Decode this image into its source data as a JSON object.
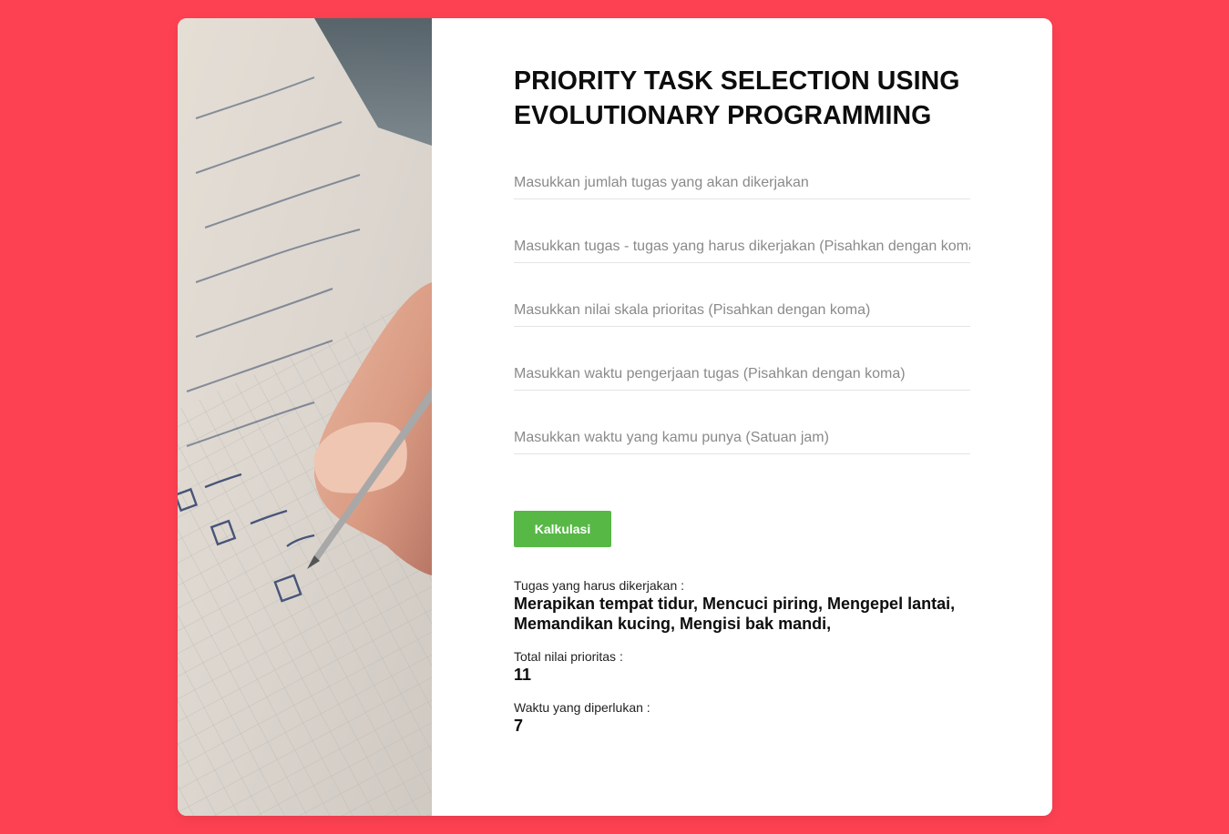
{
  "header": {
    "title_line1": "PRIORITY TASK SELECTION USING",
    "title_line2": "EVOLUTIONARY PROGRAMMING"
  },
  "form": {
    "fields": [
      {
        "placeholder": "Masukkan jumlah tugas yang akan dikerjakan",
        "value": ""
      },
      {
        "placeholder": "Masukkan tugas - tugas yang harus dikerjakan (Pisahkan dengan koma)",
        "value": ""
      },
      {
        "placeholder": "Masukkan nilai skala prioritas (Pisahkan dengan koma)",
        "value": ""
      },
      {
        "placeholder": "Masukkan waktu pengerjaan tugas (Pisahkan dengan koma)",
        "value": ""
      },
      {
        "placeholder": "Masukkan waktu yang kamu punya (Satuan jam)",
        "value": ""
      }
    ],
    "submit_label": "Kalkulasi"
  },
  "results": {
    "tasks_label": "Tugas yang harus dikerjakan :",
    "tasks_value": "Merapikan tempat tidur, Mencuci piring, Mengepel lantai, Memandikan kucing, Mengisi bak mandi,",
    "priority_label": "Total nilai prioritas :",
    "priority_value": "11",
    "time_label": "Waktu yang diperlukan :",
    "time_value": "7"
  },
  "colors": {
    "background": "#fd4152",
    "button": "#57b846",
    "card": "#ffffff"
  },
  "icons": {
    "hero_image": "notebook-checklist-photo"
  }
}
